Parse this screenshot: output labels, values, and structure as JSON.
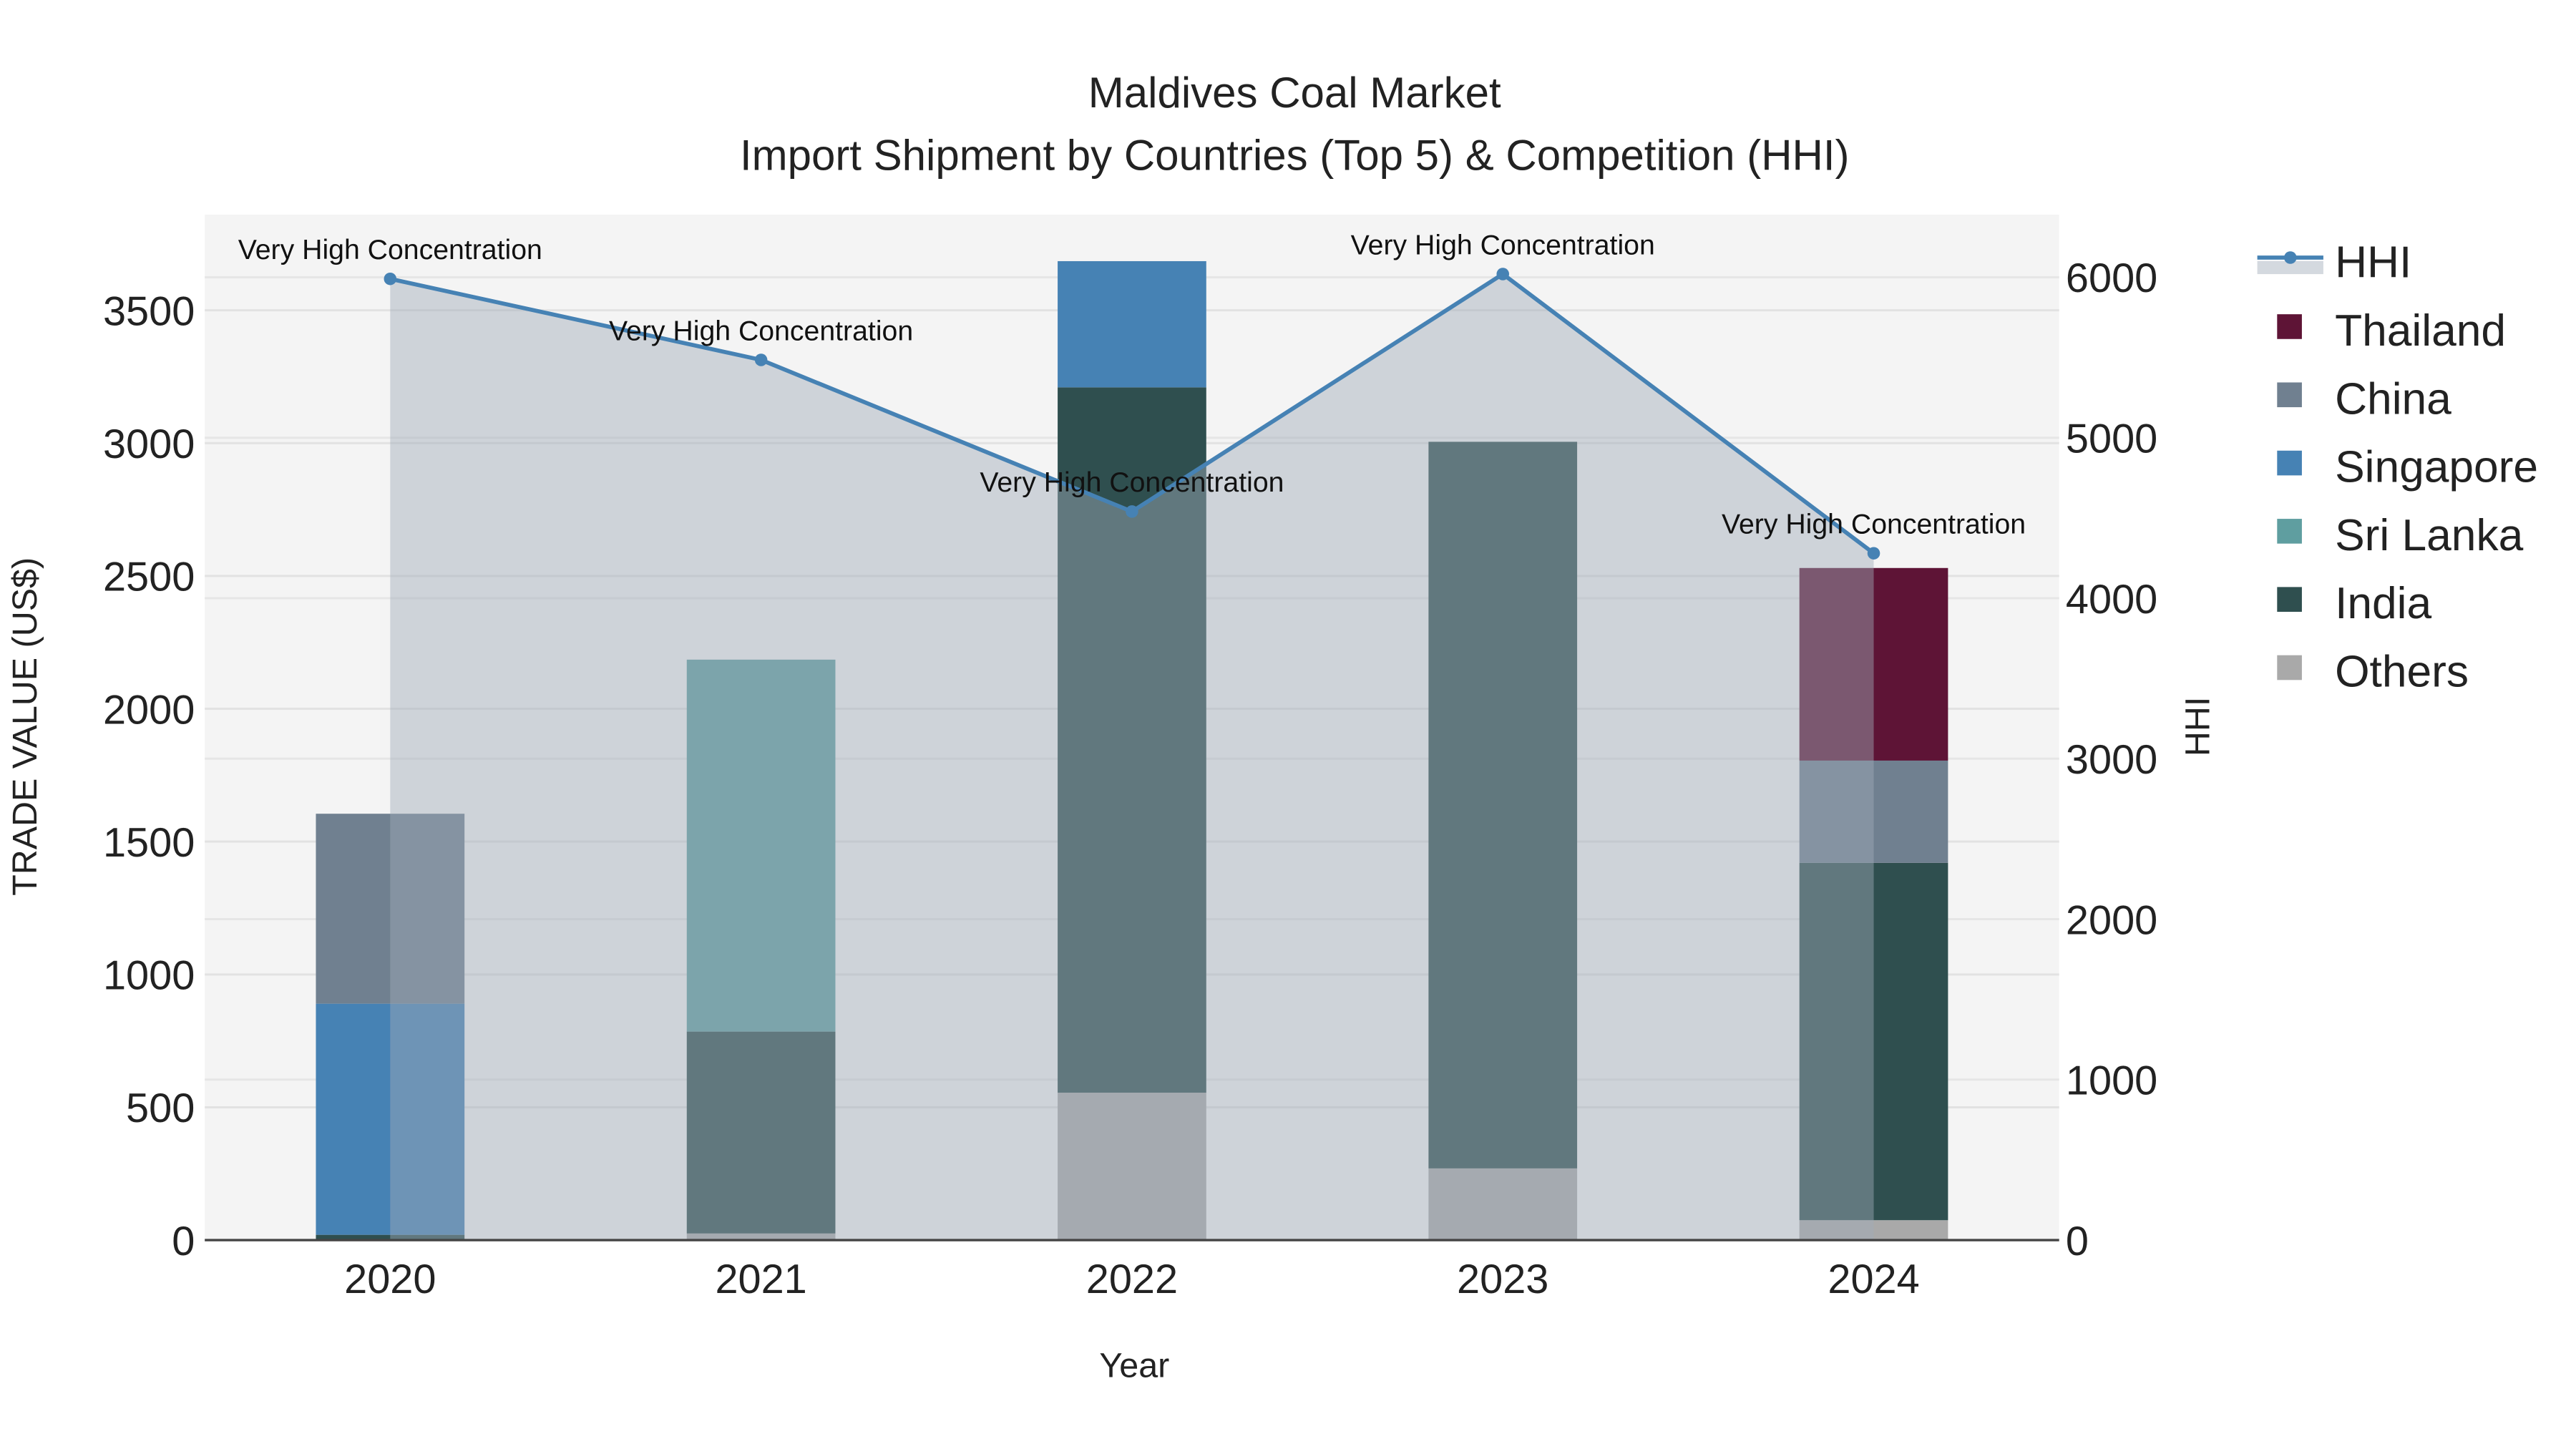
{
  "chart_data": {
    "type": "bar",
    "title_line1": "Maldives Coal Market",
    "title_line2": "Import Shipment by Countries (Top 5) & Competition (HHI)",
    "xlabel": "Year",
    "ylabel": "TRADE VALUE (US$)",
    "y2label": "HHI",
    "categories": [
      "2020",
      "2021",
      "2022",
      "2023",
      "2024"
    ],
    "ylim": [
      0,
      3860
    ],
    "y2lim": [
      0,
      6390
    ],
    "yticks": [
      0,
      500,
      1000,
      1500,
      2000,
      2500,
      3000,
      3500
    ],
    "y2ticks": [
      0,
      1000,
      2000,
      3000,
      4000,
      5000,
      6000
    ],
    "stacked": true,
    "series": [
      {
        "name": "Others",
        "color": "#a9a9a9",
        "values": [
          0,
          25,
          555,
          270,
          75
        ]
      },
      {
        "name": "India",
        "color": "#2f4f4f",
        "values": [
          20,
          760,
          2655,
          2735,
          1345
        ]
      },
      {
        "name": "Sri Lanka",
        "color": "#5f9ea0",
        "values": [
          0,
          1400,
          0,
          0,
          0
        ]
      },
      {
        "name": "Singapore",
        "color": "#4682b4",
        "values": [
          870,
          0,
          475,
          0,
          0
        ]
      },
      {
        "name": "China",
        "color": "#708090",
        "values": [
          715,
          0,
          0,
          0,
          385
        ]
      },
      {
        "name": "Thailand",
        "color": "#5e1436",
        "values": [
          0,
          0,
          0,
          0,
          725
        ]
      }
    ],
    "hhi": {
      "name": "HHI",
      "color": "#4682b4",
      "values": [
        5990,
        5485,
        4540,
        6020,
        4280
      ]
    },
    "annotations": [
      "Very High Concentration",
      "Very High Concentration",
      "Very High Concentration",
      "Very High Concentration",
      "Very High Concentration"
    ],
    "legend": [
      "HHI",
      "Thailand",
      "China",
      "Singapore",
      "Sri Lanka",
      "India",
      "Others"
    ],
    "legend_position": "right",
    "grid": true
  }
}
